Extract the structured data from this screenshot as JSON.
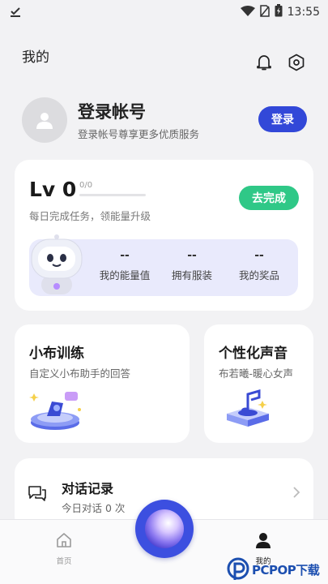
{
  "status_bar": {
    "time": "13:55"
  },
  "header": {
    "title": "我的"
  },
  "profile": {
    "title": "登录帐号",
    "subtitle": "登录帐号尊享更多优质服务",
    "login_label": "登录"
  },
  "level": {
    "title": "Lv 0",
    "progress_text": "0/0",
    "description": "每日完成任务，领能量升级",
    "complete_label": "去完成",
    "stats": [
      {
        "value": "--",
        "label": "我的能量值"
      },
      {
        "value": "--",
        "label": "拥有服装"
      },
      {
        "value": "--",
        "label": "我的奖品"
      }
    ]
  },
  "training": {
    "title": "小布训练",
    "subtitle": "自定义小布助手的回答"
  },
  "voice": {
    "title": "个性化声音",
    "subtitle": "布若曦-暖心女声"
  },
  "history": {
    "title": "对话记录",
    "subtitle": "今日对话 0 次"
  },
  "bottom_nav": {
    "home_label": "首页",
    "mine_label": "我的"
  },
  "watermark": {
    "text": "PCPOP下载"
  },
  "colors": {
    "primary": "#3248d8",
    "success": "#2fc887",
    "background": "#f2f2f4"
  }
}
